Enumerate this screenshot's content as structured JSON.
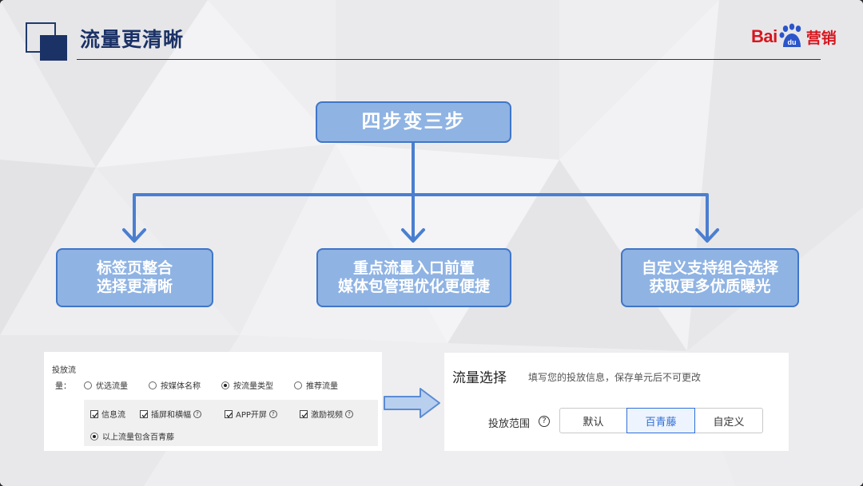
{
  "header": {
    "title": "流量更清晰",
    "brand": {
      "latin": "Bai",
      "paw_text": "du",
      "cn": "营销",
      "color": "#d7161e"
    }
  },
  "flow": {
    "top": "四步变三步",
    "left": {
      "line1": "标签页整合",
      "line2": "选择更清晰"
    },
    "middle": {
      "line1": "重点流量入口前置",
      "line2": "媒体包管理优化更便捷"
    },
    "right": {
      "line1": "自定义支持组合选择",
      "line2": "获取更多优质曝光"
    },
    "box_fill": "#8fb3e3",
    "box_border": "#3f76c8"
  },
  "old_ui": {
    "label_line1": "投放流",
    "label_line2": "量：",
    "radios": [
      {
        "label": "优选流量",
        "selected": false
      },
      {
        "label": "按媒体名称",
        "selected": false
      },
      {
        "label": "按流量类型",
        "selected": true
      },
      {
        "label": "推荐流量",
        "selected": false
      }
    ],
    "checkboxes": [
      {
        "label": "信息流",
        "checked": true,
        "help": false
      },
      {
        "label": "插屏和横幅",
        "checked": true,
        "help": true
      },
      {
        "label": "APP开屏",
        "checked": true,
        "help": true
      },
      {
        "label": "激励视频",
        "checked": true,
        "help": true
      }
    ],
    "include_option": {
      "label": "以上流量包含百青藤",
      "selected": true
    },
    "help_glyph": "?"
  },
  "new_ui": {
    "title": "流量选择",
    "hint": "填写您的投放信息，保存单元后不可更改",
    "scope_label": "投放范围",
    "help_glyph": "?",
    "segments": [
      {
        "label": "默认",
        "active": false
      },
      {
        "label": "百青藤",
        "active": true
      },
      {
        "label": "自定义",
        "active": false
      }
    ],
    "active_color": "#2f6fd6"
  }
}
